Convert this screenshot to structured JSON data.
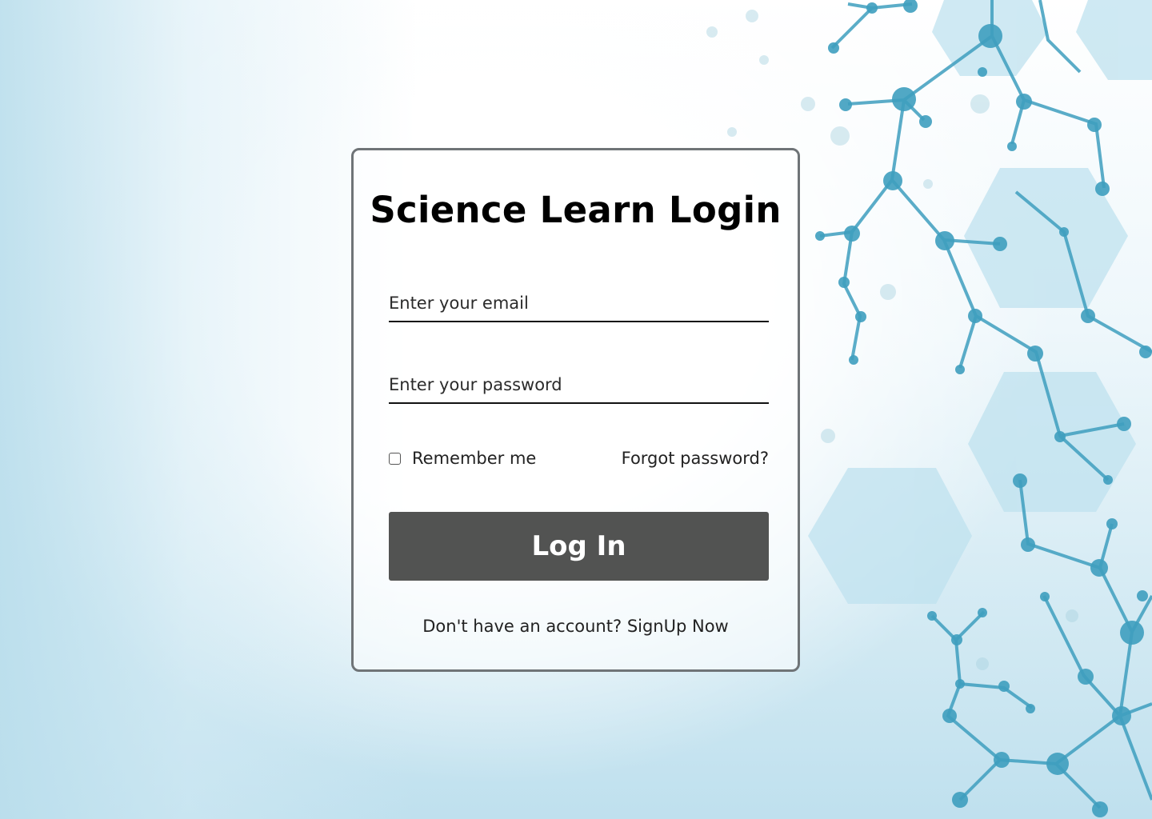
{
  "login": {
    "title": "Science Learn Login",
    "email_placeholder": "Enter your email",
    "password_placeholder": "Enter your password",
    "remember_label": "Remember me",
    "forgot_label": "Forgot password?",
    "login_button": "Log In",
    "signup_prompt": "Don't have an account?",
    "signup_link": "SignUp Now"
  },
  "colors": {
    "button": "#525352",
    "card_border": "#6f7477",
    "molecule": "#3f9fbf",
    "hexagon": "#bfe2ef"
  },
  "background_icon": "molecule-network-illustration"
}
